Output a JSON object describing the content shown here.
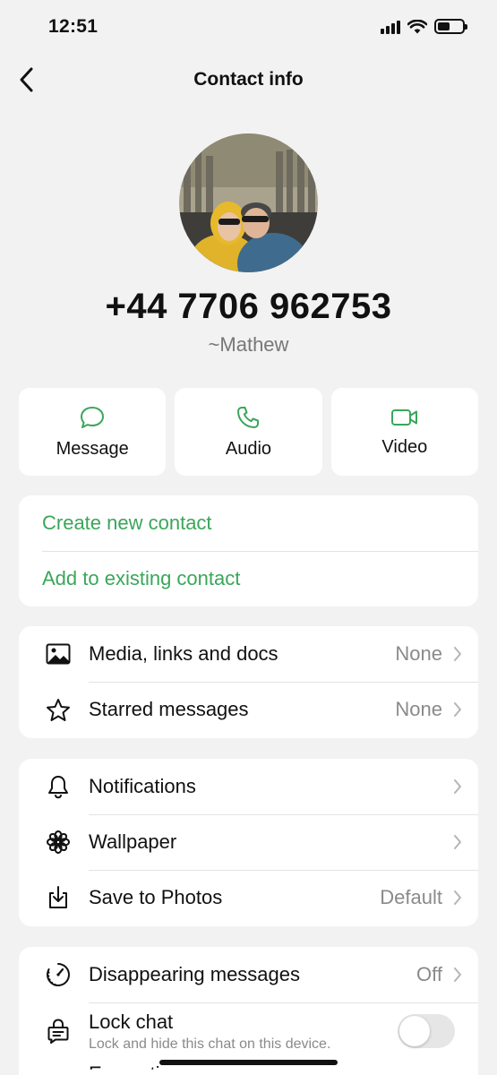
{
  "status_bar": {
    "time": "12:51",
    "battery_level": 0.5
  },
  "nav": {
    "title": "Contact info"
  },
  "contact": {
    "phone": "+44 7706 962753",
    "alias": "~Mathew"
  },
  "actions": [
    {
      "label": "Message",
      "icon": "chat-bubble-icon"
    },
    {
      "label": "Audio",
      "icon": "phone-icon"
    },
    {
      "label": "Video",
      "icon": "video-camera-icon"
    }
  ],
  "contact_actions": {
    "create": "Create new contact",
    "add_existing": "Add to existing contact"
  },
  "media": {
    "items": [
      {
        "label": "Media, links and docs",
        "value": "None",
        "icon": "image-icon"
      },
      {
        "label": "Starred messages",
        "value": "None",
        "icon": "star-icon"
      }
    ]
  },
  "settings": {
    "items": [
      {
        "label": "Notifications",
        "value": "",
        "icon": "bell-icon"
      },
      {
        "label": "Wallpaper",
        "value": "",
        "icon": "flower-icon"
      },
      {
        "label": "Save to Photos",
        "value": "Default",
        "icon": "download-icon"
      }
    ]
  },
  "privacy": {
    "disappearing": {
      "label": "Disappearing messages",
      "value": "Off"
    },
    "lock": {
      "label": "Lock chat",
      "sublabel": "Lock and hide this chat on this device.",
      "enabled": false
    },
    "next_peek": "Encryption"
  },
  "colors": {
    "accent": "#3aa65a",
    "background": "#f2f2f2"
  }
}
